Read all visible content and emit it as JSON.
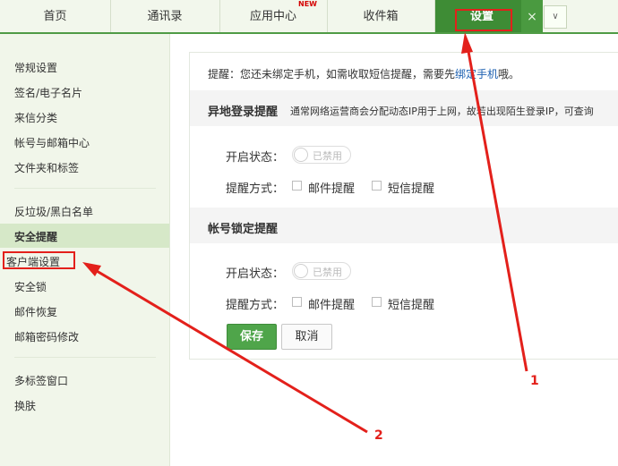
{
  "tabs": [
    {
      "label": "首页"
    },
    {
      "label": "通讯录"
    },
    {
      "label": "应用中心",
      "badge": "NEW"
    },
    {
      "label": "收件箱"
    },
    {
      "label": "设置",
      "active": true
    }
  ],
  "tab_close": "×",
  "tab_dropdown": "∨",
  "sidebar": {
    "items": [
      {
        "label": "常规设置"
      },
      {
        "label": "签名/电子名片"
      },
      {
        "label": "来信分类"
      },
      {
        "label": "帐号与邮箱中心"
      },
      {
        "label": "文件夹和标签"
      },
      {
        "label": "反垃圾/黑白名单"
      },
      {
        "label": "安全提醒",
        "selected": true
      },
      {
        "label": "客户端设置",
        "highlighted": true
      },
      {
        "label": "安全锁"
      },
      {
        "label": "邮件恢复"
      },
      {
        "label": "邮箱密码修改"
      },
      {
        "label": "多标签窗口"
      },
      {
        "label": "换肤"
      }
    ]
  },
  "main": {
    "tip_prefix": "提醒：您还未绑定手机，如需收取短信提醒，需要先",
    "tip_link": "绑定手机",
    "tip_suffix": "哦。",
    "remote_login": {
      "title": "异地登录提醒",
      "desc": "通常网络运营商会分配动态IP用于上网，故若出现陌生登录IP，可查询",
      "status_label": "开启状态：",
      "status_value": "已禁用",
      "method_label": "提醒方式：",
      "option_mail": "邮件提醒",
      "option_sms": "短信提醒"
    },
    "account_lock": {
      "title": "帐号锁定提醒",
      "status_label": "开启状态：",
      "status_value": "已禁用",
      "method_label": "提醒方式：",
      "option_mail": "邮件提醒",
      "option_sms": "短信提醒"
    },
    "save_label": "保存",
    "cancel_label": "取消"
  },
  "annotations": {
    "arrow1_label": "1",
    "arrow2_label": "2"
  },
  "colors": {
    "accent_green": "#3e8c35",
    "annotation_red": "#e3201b",
    "link_blue": "#1b5fb0"
  }
}
